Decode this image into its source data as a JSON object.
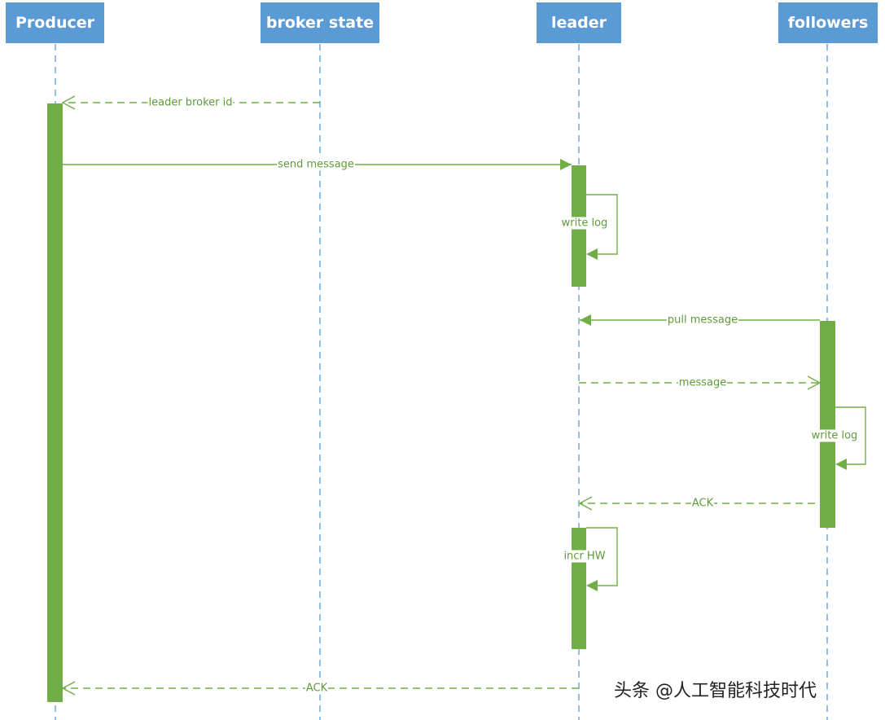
{
  "participants": [
    {
      "id": "producer",
      "label": "Producer"
    },
    {
      "id": "broker_state",
      "label": "broker state"
    },
    {
      "id": "leader",
      "label": "leader"
    },
    {
      "id": "followers",
      "label": "followers"
    }
  ],
  "messages": [
    {
      "label": "leader broker id",
      "from": "broker_state",
      "to": "producer",
      "style": "dashed-reply"
    },
    {
      "label": "send message",
      "from": "producer",
      "to": "leader",
      "style": "solid-sync"
    },
    {
      "label": "write log",
      "from": "leader",
      "to": "leader",
      "style": "self"
    },
    {
      "label": "pull message",
      "from": "followers",
      "to": "leader",
      "style": "solid-sync"
    },
    {
      "label": "message",
      "from": "leader",
      "to": "followers",
      "style": "dashed-reply"
    },
    {
      "label": "write log",
      "from": "followers",
      "to": "followers",
      "style": "self"
    },
    {
      "label": "ACK",
      "from": "followers",
      "to": "leader",
      "style": "dashed-reply"
    },
    {
      "label": "incr HW",
      "from": "leader",
      "to": "leader",
      "style": "self"
    },
    {
      "label": "ACK",
      "from": "leader",
      "to": "producer",
      "style": "dashed-reply"
    }
  ],
  "watermark": "头条 @人工智能科技时代",
  "colors": {
    "header": "#5b9bd5",
    "lifeline": "#5b9bd5",
    "activation": "#70ad47",
    "message": "#70ad47"
  }
}
